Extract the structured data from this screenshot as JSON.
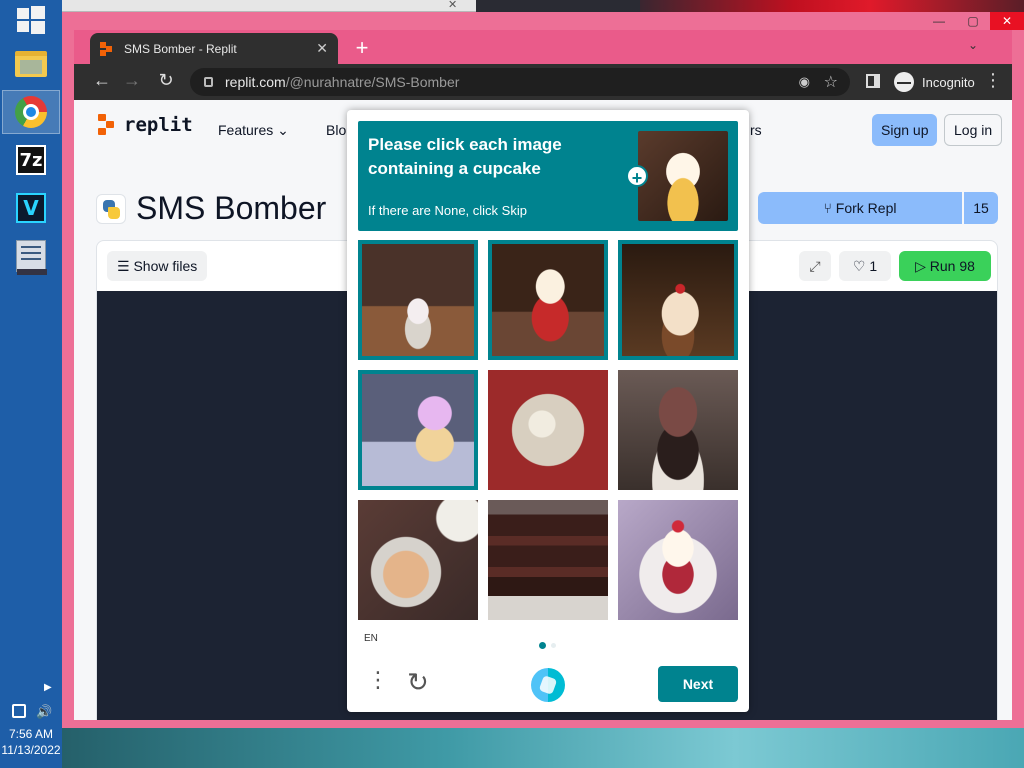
{
  "taskbar": {
    "apps": [
      "File Explorer",
      "Google Chrome",
      "7-Zip",
      "V",
      "Task Manager"
    ],
    "seven_zip_label": "7z",
    "v_label": "V",
    "clock_time": "7:56 AM",
    "clock_date": "11/13/2022"
  },
  "browser": {
    "tab_title": "SMS Bomber - Replit",
    "new_tab_symbol": "+",
    "url_host": "replit.com",
    "url_path": "/@nurahnatre/SMS-Bomber",
    "profile_label": "Incognito",
    "frame_color": "#ed6f96"
  },
  "replit": {
    "logo_text": "replit",
    "nav_features": "Features",
    "nav_blog": "Blo",
    "nav_rs": "rs",
    "signup": "Sign up",
    "login": "Log in",
    "repl_title": "SMS Bomber",
    "fork_label": "Fork Repl",
    "fork_count": "15",
    "show_files": "Show files",
    "likes": "1",
    "run_label": "Run",
    "run_count": "98",
    "accent_blue": "#8bbbfb",
    "run_green": "#3ad15a"
  },
  "captcha": {
    "prompt_title": "Please click each image containing a cupcake",
    "prompt_sub": "If there are None, click Skip",
    "zoom_symbol": "+",
    "language": "EN",
    "next_label": "Next",
    "accent": "#00838f",
    "tiles": [
      {
        "desc": "cupcake on wooden table",
        "selected": true
      },
      {
        "desc": "cupcake with red wrapper",
        "selected": true
      },
      {
        "desc": "cupcake with cherry",
        "selected": true
      },
      {
        "desc": "colorful frosted cupcake",
        "selected": true
      },
      {
        "desc": "dessert on plate",
        "selected": false
      },
      {
        "desc": "chocolate cupcake",
        "selected": false
      },
      {
        "desc": "pancakes on plate",
        "selected": false
      },
      {
        "desc": "chocolate layer cake",
        "selected": false
      },
      {
        "desc": "cupcake on plate",
        "selected": false
      }
    ]
  }
}
